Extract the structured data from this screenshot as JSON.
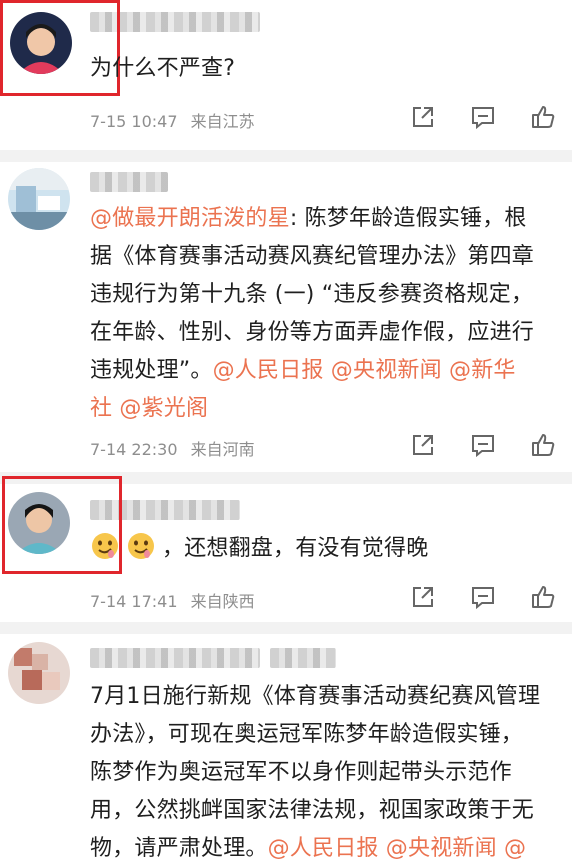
{
  "comments": [
    {
      "text": "为什么不严查?",
      "meta": {
        "time": "7-15 10:47",
        "location": "来自江苏"
      }
    },
    {
      "lines": [
        [
          {
            "t": "@做最开朗活泼的星",
            "m": true
          },
          {
            "t": ": 陈梦年龄造假实锤，根",
            "m": false
          }
        ],
        [
          {
            "t": "据《体育赛事活动赛风赛纪管理办法》第四章",
            "m": false
          }
        ],
        [
          {
            "t": "违规行为第十九条 (一) “违反参赛资格规定，",
            "m": false
          }
        ],
        [
          {
            "t": "在年龄、性别、身份等方面弄虚作假，应进行",
            "m": false
          }
        ],
        [
          {
            "t": "违规处理”。",
            "m": false
          },
          {
            "t": "@人民日报 @央视新闻 @新华",
            "m": true
          }
        ],
        [
          {
            "t": "社 @紫光阁",
            "m": true
          }
        ]
      ],
      "meta": {
        "time": "7-14 22:30",
        "location": "来自河南"
      }
    },
    {
      "text": "，还想翻盘，有没有觉得晚",
      "emoji_names": [
        "drooling-face-emoji",
        "drooling-face-emoji"
      ],
      "meta": {
        "time": "7-14 17:41",
        "location": "来自陕西"
      }
    },
    {
      "lines": [
        [
          {
            "t": "7月1日施行新规《体育赛事活动赛纪赛风管理",
            "m": false
          }
        ],
        [
          {
            "t": "办法》，可现在奥运冠军陈梦年龄造假实锤，",
            "m": false
          }
        ],
        [
          {
            "t": "陈梦作为奥运冠军不以身作则起带头示范作",
            "m": false
          }
        ],
        [
          {
            "t": "用，公然挑衅国家法律法规，视国家政策于无",
            "m": false
          }
        ],
        [
          {
            "t": "物，请严肃处理。",
            "m": false
          },
          {
            "t": "@人民日报 @央视新闻 @",
            "m": true
          }
        ]
      ]
    }
  ],
  "icons": [
    "share-icon",
    "comment-icon",
    "like-icon"
  ],
  "colors": {
    "mention": "#eb7350",
    "highlight_box": "#e0262c",
    "meta": "#8e8e8e"
  }
}
